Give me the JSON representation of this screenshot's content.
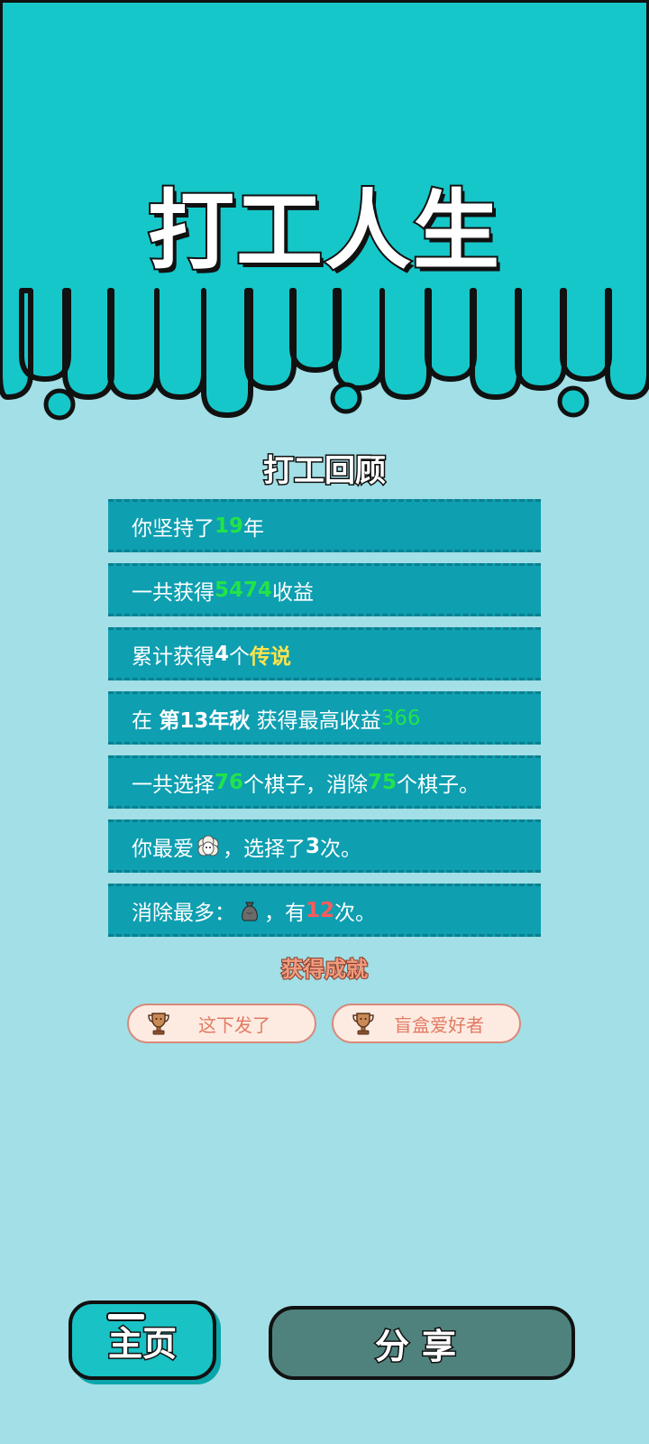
{
  "app": {
    "title": "打工人生"
  },
  "review": {
    "section_title": "打工回顾",
    "rows": [
      {
        "pre": "你坚持了",
        "num": "19",
        "post": "年"
      },
      {
        "pre": "一共获得",
        "num": "5474",
        "post": "收益"
      },
      {
        "pre": "累计获得",
        "num": "4",
        "mid": "个",
        "tag": "传说"
      },
      {
        "pre": "在 ",
        "bold": "第13年秋",
        "mid": " 获得最高收益",
        "num": "366"
      },
      {
        "pre": "一共选择",
        "num1": "76",
        "mid": "个棋子，消除",
        "num2": "75",
        "post": "个棋子。"
      },
      {
        "pre": "你最爱",
        "icon": "sheep-icon",
        "mid": "，选择了",
        "num": "3",
        "post": "次。"
      },
      {
        "pre": "消除最多：",
        "icon": "garbage-bag-icon",
        "mid": "，有",
        "num": "12",
        "post": "次。"
      }
    ]
  },
  "achievements": {
    "title": "获得成就",
    "items": [
      {
        "label": "这下发了",
        "icon": "trophy-icon"
      },
      {
        "label": "盲盒爱好者",
        "icon": "trophy-icon"
      }
    ]
  },
  "buttons": {
    "home": "主页",
    "share": "分享"
  },
  "colors": {
    "top_band": "#16c7c9",
    "background": "#a2dfe6",
    "row": "#0e9fb1",
    "highlight_green": "#22e34a",
    "highlight_yellow": "#ffe44a",
    "highlight_red": "#ff5a5a",
    "share_button": "#4f827d"
  }
}
